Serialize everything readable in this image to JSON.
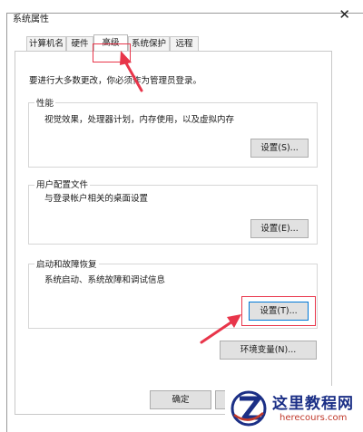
{
  "window": {
    "title": "系统属性",
    "close_glyph": "✕"
  },
  "tabs": [
    {
      "label": "计算机名"
    },
    {
      "label": "硬件"
    },
    {
      "label": "高级"
    },
    {
      "label": "系统保护"
    },
    {
      "label": "远程"
    }
  ],
  "notice": "要进行大多数更改，你必须作为管理员登录。",
  "performance": {
    "label": "性能",
    "desc": "视觉效果，处理器计划，内存使用，以及虚拟内存",
    "button": "设置(S)..."
  },
  "profile": {
    "label": "用户配置文件",
    "desc": "与登录帐户相关的桌面设置",
    "button": "设置(E)..."
  },
  "startup": {
    "label": "启动和故障恢复",
    "desc": "系统启动、系统故障和调试信息",
    "button": "设置(T)..."
  },
  "env_button": "环境变量(N)...",
  "footer": {
    "ok": "确定"
  },
  "watermark": {
    "name": "这里教程网",
    "url": "herecours.com"
  },
  "colors": {
    "highlight": "#e8354a",
    "focus": "#0078d7",
    "watermark_blue": "#1b2f86"
  }
}
